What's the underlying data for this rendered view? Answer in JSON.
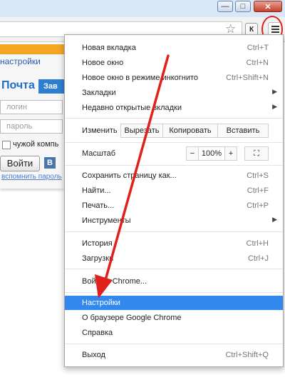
{
  "window": {
    "minimize_glyph": "—",
    "maximize_glyph": "□",
    "close_glyph": "✕"
  },
  "toolbar": {
    "bookmark_star_glyph": "☆",
    "extension_label": "К",
    "menu_icon": "hamburger-menu-icon"
  },
  "page": {
    "settings_link": "настройки",
    "mail_title": "Почта",
    "register_button": "Зав",
    "login_placeholder": "логин",
    "password_placeholder": "пароль",
    "foreign_computer_label": "чужой компь",
    "login_button": "Войти",
    "vk_label": "В",
    "remember_password": "вспомнить пароль"
  },
  "menu": {
    "items_top": [
      {
        "label": "Новая вкладка",
        "shortcut": "Ctrl+T"
      },
      {
        "label": "Новое окно",
        "shortcut": "Ctrl+N"
      },
      {
        "label": "Новое окно в режиме инкогнито",
        "shortcut": "Ctrl+Shift+N"
      },
      {
        "label": "Закладки",
        "submenu": "▶"
      },
      {
        "label": "Недавно открытые вкладки",
        "submenu": "▶"
      }
    ],
    "edit": {
      "label": "Изменить",
      "cut": "Вырезать",
      "copy": "Копировать",
      "paste": "Вставить"
    },
    "zoom": {
      "label": "Масштаб",
      "minus": "−",
      "value": "100%",
      "plus": "+",
      "fullscreen": "⛶"
    },
    "items_mid": [
      {
        "label": "Сохранить страницу как...",
        "shortcut": "Ctrl+S"
      },
      {
        "label": "Найти...",
        "shortcut": "Ctrl+F"
      },
      {
        "label": "Печать...",
        "shortcut": "Ctrl+P"
      },
      {
        "label": "Инструменты",
        "submenu": "▶"
      }
    ],
    "items_history": [
      {
        "label": "История",
        "shortcut": "Ctrl+H"
      },
      {
        "label": "Загрузки",
        "shortcut": "Ctrl+J"
      }
    ],
    "sign_in": "Войти в Chrome...",
    "items_bottom": [
      {
        "label": "Настройки",
        "highlighted": true
      },
      {
        "label": "О браузере Google Chrome"
      },
      {
        "label": "Справка"
      }
    ],
    "exit": {
      "label": "Выход",
      "shortcut": "Ctrl+Shift+Q"
    }
  },
  "colors": {
    "highlight": "#3388ee",
    "annotation": "#e0201b",
    "mail_orange": "#f5a623"
  }
}
